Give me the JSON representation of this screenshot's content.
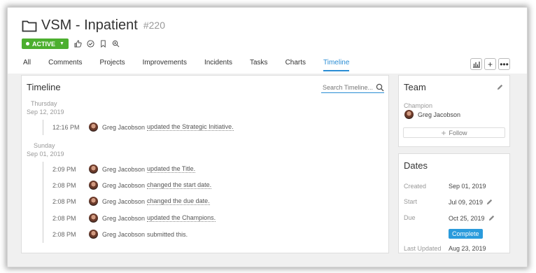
{
  "header": {
    "title": "VSM - Inpatient",
    "ticket": "#220",
    "status": "ACTIVE"
  },
  "tabs": [
    {
      "label": "All"
    },
    {
      "label": "Comments"
    },
    {
      "label": "Projects"
    },
    {
      "label": "Improvements"
    },
    {
      "label": "Incidents"
    },
    {
      "label": "Tasks"
    },
    {
      "label": "Charts"
    },
    {
      "label": "Timeline",
      "active": true
    }
  ],
  "timeline": {
    "title": "Timeline",
    "search_placeholder": "Search Timeline...",
    "groups": [
      {
        "day": "Thursday",
        "date": "Sep 12, 2019",
        "entries": [
          {
            "time": "12:16 PM",
            "user": "Greg Jacobson",
            "action": "updated the Strategic Initiative."
          }
        ]
      },
      {
        "day": "Sunday",
        "date": "Sep 01, 2019",
        "entries": [
          {
            "time": "2:09 PM",
            "user": "Greg Jacobson",
            "action": "updated the Title."
          },
          {
            "time": "2:08 PM",
            "user": "Greg Jacobson",
            "action": "changed the start date."
          },
          {
            "time": "2:08 PM",
            "user": "Greg Jacobson",
            "action": "changed the due date."
          },
          {
            "time": "2:08 PM",
            "user": "Greg Jacobson",
            "action": "updated the Champions."
          },
          {
            "time": "2:08 PM",
            "user": "Greg Jacobson",
            "action": "submitted this."
          }
        ]
      }
    ]
  },
  "team": {
    "title": "Team",
    "role_label": "Champion",
    "champion": "Greg Jacobson",
    "follow_label": "Follow"
  },
  "dates": {
    "title": "Dates",
    "created_label": "Created",
    "created": "Sep 01, 2019",
    "start_label": "Start",
    "start": "Jul 09, 2019",
    "due_label": "Due",
    "due": "Oct 25, 2019",
    "complete_label": "Complete",
    "updated_label": "Last Updated",
    "updated": "Aug 23, 2019"
  },
  "colors": {
    "accent": "#2a8dd4",
    "status_green": "#4caf2f",
    "complete_blue": "#2a9bdc"
  },
  "icons": [
    "folder-icon",
    "thumbs-up-icon",
    "check-circle-icon",
    "bookmark-icon",
    "search-icon",
    "bar-chart-icon",
    "plus-icon",
    "more-icon",
    "pencil-icon"
  ]
}
